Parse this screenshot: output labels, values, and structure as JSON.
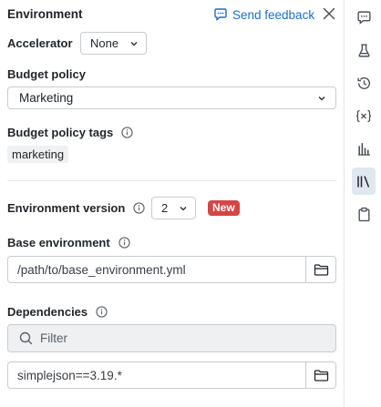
{
  "header": {
    "title": "Environment",
    "feedback_label": "Send feedback"
  },
  "accelerator": {
    "label": "Accelerator",
    "value": "None"
  },
  "budget_policy": {
    "label": "Budget policy",
    "value": "Marketing"
  },
  "budget_policy_tags": {
    "label": "Budget policy tags",
    "tags": [
      "marketing"
    ]
  },
  "environment_version": {
    "label": "Environment version",
    "value": "2",
    "badge": "New"
  },
  "base_environment": {
    "label": "Base environment",
    "value": "/path/to/base_environment.yml"
  },
  "dependencies": {
    "label": "Dependencies",
    "filter_placeholder": "Filter",
    "items": [
      "simplejson==3.19.*"
    ]
  },
  "rail": {
    "icons": [
      "comment-icon",
      "flask-icon",
      "history-icon",
      "variables-icon",
      "chart-icon",
      "library-icon",
      "clipboard-icon"
    ],
    "active": "library-icon"
  },
  "colors": {
    "accent": "#1a6fd1",
    "badge": "#d64545",
    "active_rail": "#dfe7f1"
  }
}
